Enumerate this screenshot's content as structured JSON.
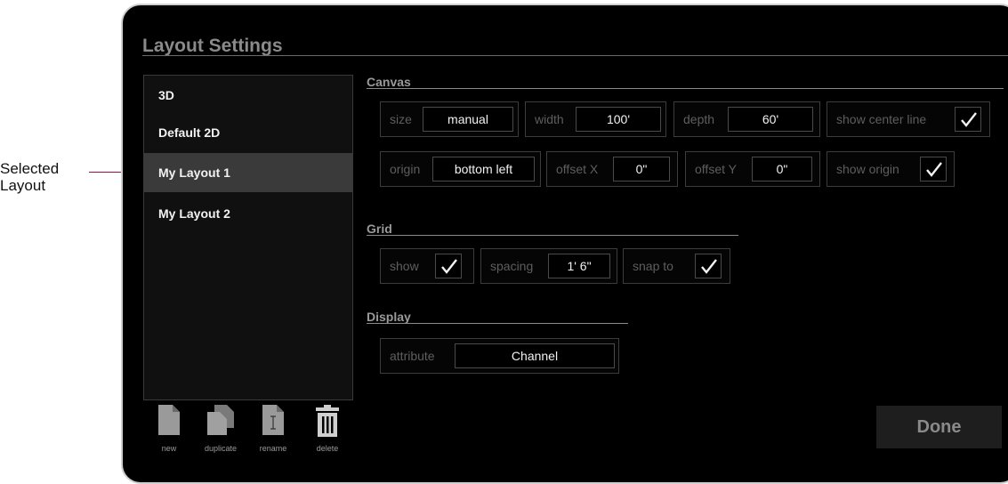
{
  "annotation": {
    "line1": "Selected",
    "line2": "Layout"
  },
  "title": "Layout Settings",
  "layouts": [
    {
      "label": "3D",
      "selected": false
    },
    {
      "label": "Default 2D",
      "selected": false
    },
    {
      "label": "My Layout 1",
      "selected": true
    },
    {
      "label": "My Layout 2",
      "selected": false
    }
  ],
  "tools": {
    "new": "new",
    "duplicate": "duplicate",
    "rename": "rename",
    "delete": "delete"
  },
  "canvas": {
    "heading": "Canvas",
    "size": {
      "label": "size",
      "value": "manual"
    },
    "width": {
      "label": "width",
      "value": "100'"
    },
    "depth": {
      "label": "depth",
      "value": "60'"
    },
    "show_center_line": {
      "label": "show center line",
      "checked": true
    },
    "origin": {
      "label": "origin",
      "value": "bottom left"
    },
    "offset_x": {
      "label": "offset X",
      "value": "0\""
    },
    "offset_y": {
      "label": "offset Y",
      "value": "0\""
    },
    "show_origin": {
      "label": "show origin",
      "checked": true
    }
  },
  "grid": {
    "heading": "Grid",
    "show": {
      "label": "show",
      "checked": true
    },
    "spacing": {
      "label": "spacing",
      "value": "1' 6\""
    },
    "snap_to": {
      "label": "snap to",
      "checked": true
    }
  },
  "display": {
    "heading": "Display",
    "attribute": {
      "label": "attribute",
      "value": "Channel"
    }
  },
  "done_label": "Done",
  "colors": {
    "panel_bg": "#000000",
    "selected_row": "#3a3a3a",
    "annotation_line": "#a0103a"
  }
}
